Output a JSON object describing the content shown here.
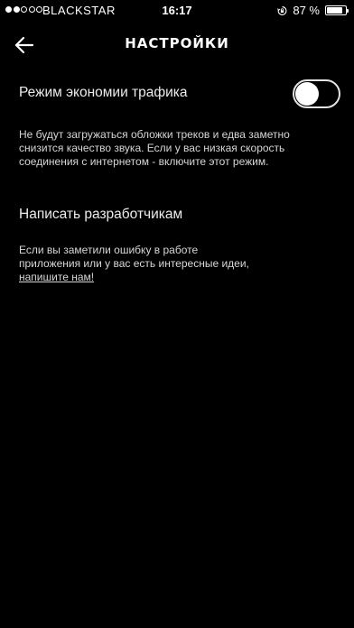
{
  "status_bar": {
    "carrier": "BLACKSTAR",
    "time": "16:17",
    "battery_percent": "87 %",
    "battery_level": 0.87,
    "icons": [
      "signal-dots",
      "rotation-lock-icon",
      "battery-icon"
    ]
  },
  "header": {
    "title": "НАСТРОЙКИ",
    "back_icon": "arrow-left-icon"
  },
  "traffic_saving": {
    "title": "Режим экономии трафика",
    "enabled": false,
    "description": "Не будут загружаться обложки треков и едва заметно снизится качество звука. Если у вас низкая скорость соединения с интернетом - включите этот режим."
  },
  "feedback": {
    "title": "Написать разработчикам",
    "description": "Если вы заметили ошибку в работе приложения или у вас есть интересные идеи,",
    "link_text": "напишите нам!"
  },
  "colors": {
    "background": "#000000",
    "text": "#ffffff",
    "secondary_text": "#d6d6d6"
  }
}
